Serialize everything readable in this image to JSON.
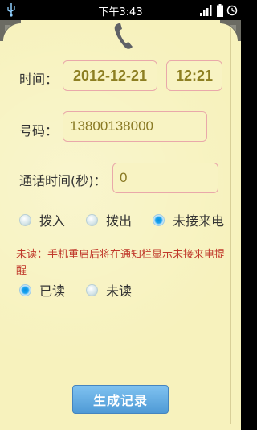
{
  "status_bar": {
    "time": "下午3:43"
  },
  "form": {
    "time_label": "时间：",
    "date_value": "2012-12-21",
    "time_value": "12:21",
    "number_label": "号码：",
    "number_value": "13800138000",
    "duration_label": "通话时间(秒)：",
    "duration_value": "0"
  },
  "call_type": {
    "options": [
      {
        "label": "拨入",
        "checked": false
      },
      {
        "label": "拨出",
        "checked": false
      },
      {
        "label": "未接来电",
        "checked": true
      }
    ]
  },
  "hint_text": "未读：手机重启后将在通知栏显示未接来电提醒",
  "read_status": {
    "options": [
      {
        "label": "已读",
        "checked": true
      },
      {
        "label": "未读",
        "checked": false
      }
    ]
  },
  "generate_button": "生成记录",
  "colors": {
    "paper": "#f7f2bd",
    "field_border": "#e9a8aa",
    "value_text": "#8a7a25",
    "hint_text": "#c0392b",
    "radio_checked": "#1aa4f0",
    "button": "#5aa6de"
  }
}
